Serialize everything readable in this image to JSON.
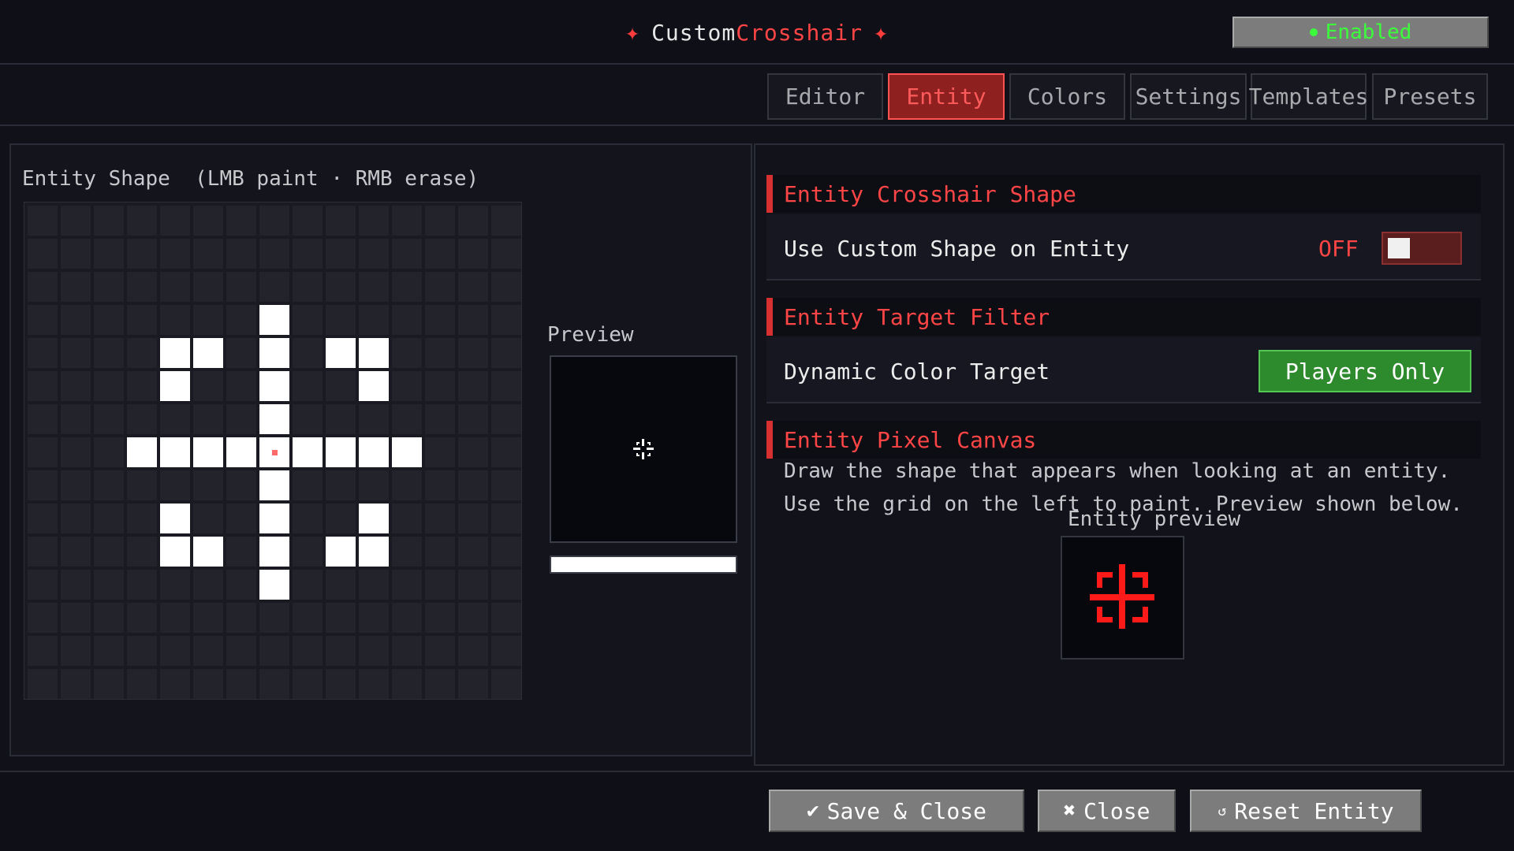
{
  "header": {
    "title_prefix": "Custom",
    "title_accent": "Crosshair",
    "star_glyph": "✦",
    "enabled_label": "Enabled"
  },
  "tabs": [
    {
      "label": "Editor",
      "active": false
    },
    {
      "label": "Entity",
      "active": true
    },
    {
      "label": "Colors",
      "active": false
    },
    {
      "label": "Settings",
      "active": false
    },
    {
      "label": "Templates",
      "active": false
    },
    {
      "label": "Presets",
      "active": false
    }
  ],
  "editor": {
    "shape_label": "Entity Shape  (LMB paint · RMB erase)",
    "preview_label": "Preview",
    "grid_size": 15,
    "center_cell": [
      7,
      7
    ],
    "filled_cells": [
      [
        3,
        7
      ],
      [
        4,
        4
      ],
      [
        4,
        5
      ],
      [
        4,
        7
      ],
      [
        4,
        9
      ],
      [
        4,
        10
      ],
      [
        5,
        4
      ],
      [
        5,
        7
      ],
      [
        5,
        10
      ],
      [
        6,
        7
      ],
      [
        7,
        3
      ],
      [
        7,
        4
      ],
      [
        7,
        5
      ],
      [
        7,
        6
      ],
      [
        7,
        8
      ],
      [
        7,
        9
      ],
      [
        7,
        10
      ],
      [
        7,
        11
      ],
      [
        8,
        7
      ],
      [
        9,
        4
      ],
      [
        9,
        7
      ],
      [
        9,
        10
      ],
      [
        10,
        4
      ],
      [
        10,
        5
      ],
      [
        10,
        7
      ],
      [
        10,
        9
      ],
      [
        10,
        10
      ],
      [
        11,
        7
      ]
    ]
  },
  "sections": {
    "shape": {
      "header": "Entity Crosshair Shape",
      "use_custom_label": "Use Custom Shape on Entity",
      "toggle_state": "OFF"
    },
    "filter": {
      "header": "Entity Target Filter",
      "dynamic_label": "Dynamic Color Target",
      "dynamic_value": "Players Only"
    },
    "canvas": {
      "header": "Entity Pixel Canvas",
      "desc_line1": "Draw the shape that appears when looking at an entity.",
      "desc_line2": "Use the grid on the left to paint. Preview shown below.",
      "preview_label": "Entity preview"
    }
  },
  "footer": {
    "save_icon": "✔",
    "save_label": "Save & Close",
    "close_icon": "✖",
    "close_label": "Close",
    "reset_icon": "↺",
    "reset_label": "Reset Entity"
  },
  "colors": {
    "accent": "#ff4545",
    "tab_active_bg": "#8e2020",
    "enabled_green": "#3cff3c",
    "players_btn": "#2d8a2d",
    "preview_red": "#ff1a1a"
  }
}
